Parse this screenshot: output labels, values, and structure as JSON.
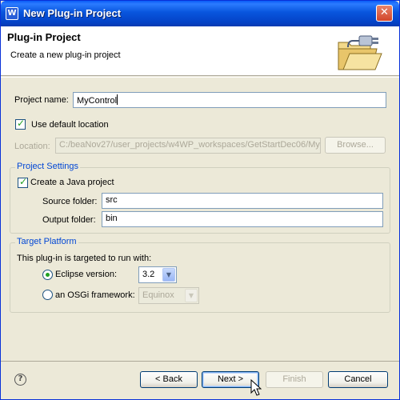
{
  "window": {
    "title": "New Plug-in Project",
    "icon": "eclipse-w-icon",
    "close_label": "✕"
  },
  "banner": {
    "title": "Plug-in Project",
    "description": "Create a new plug-in project",
    "icon": "folder-plug-icon"
  },
  "form": {
    "project_name_label": "Project name:",
    "project_name_value": "MyControl",
    "use_default_location_label": "Use default location",
    "use_default_location_checked": true,
    "location_label": "Location:",
    "location_value": "C:/beaNov27/user_projects/w4WP_workspaces/GetStartDec06/My",
    "browse_label": "Browse..."
  },
  "project_settings": {
    "title": "Project Settings",
    "create_java_label": "Create a Java project",
    "create_java_checked": true,
    "source_folder_label": "Source folder:",
    "source_folder_value": "src",
    "output_folder_label": "Output folder:",
    "output_folder_value": "bin"
  },
  "target_platform": {
    "title": "Target Platform",
    "intro": "This plug-in is targeted to run with:",
    "eclipse_label": "Eclipse version:",
    "eclipse_value": "3.2",
    "osgi_label": "an OSGi framework:",
    "osgi_value": "Equinox",
    "selected": "eclipse"
  },
  "buttons": {
    "help": "?",
    "back": "< Back",
    "next": "Next >",
    "finish": "Finish",
    "cancel": "Cancel"
  },
  "colors": {
    "title_bar": "#0855dd",
    "dialog_bg": "#ece9d8",
    "group_title": "#0046d5",
    "checkmark": "#21a121"
  }
}
